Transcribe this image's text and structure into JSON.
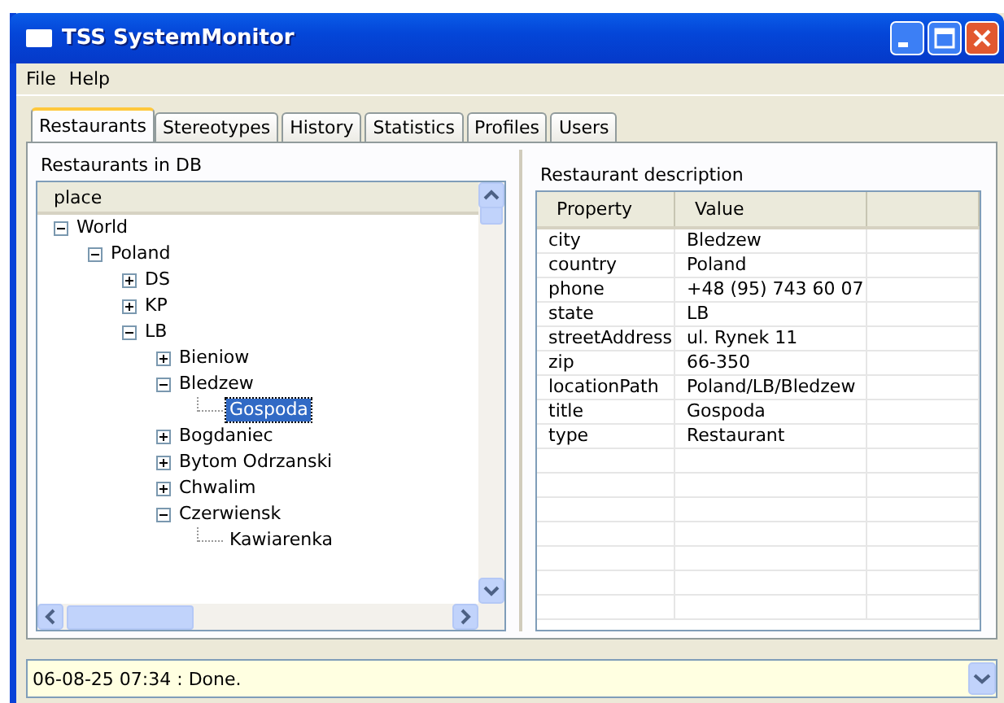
{
  "window": {
    "title": "TSS SystemMonitor"
  },
  "menu": [
    "File",
    "Help"
  ],
  "tabs": [
    {
      "label": "Restaurants",
      "selected": true
    },
    {
      "label": "Stereotypes",
      "selected": false
    },
    {
      "label": "History",
      "selected": false
    },
    {
      "label": "Statistics",
      "selected": false
    },
    {
      "label": "Profiles",
      "selected": false
    },
    {
      "label": "Users",
      "selected": false
    }
  ],
  "left_panel": {
    "title": "Restaurants in DB",
    "tree": {
      "column": "place",
      "items": [
        {
          "label": "World",
          "kind": "node",
          "expanded": true,
          "selected": false,
          "children": [
            {
              "label": "Poland",
              "kind": "node",
              "expanded": true,
              "selected": false,
              "children": [
                {
                  "label": "DS",
                  "kind": "node",
                  "expanded": false,
                  "selected": false
                },
                {
                  "label": "KP",
                  "kind": "node",
                  "expanded": false,
                  "selected": false
                },
                {
                  "label": "LB",
                  "kind": "node",
                  "expanded": true,
                  "selected": false,
                  "children": [
                    {
                      "label": "Bieniow",
                      "kind": "node",
                      "expanded": false,
                      "selected": false
                    },
                    {
                      "label": "Bledzew",
                      "kind": "node",
                      "expanded": true,
                      "selected": false,
                      "children": [
                        {
                          "label": "Gospoda",
                          "kind": "leaf",
                          "selected": true
                        }
                      ]
                    },
                    {
                      "label": "Bogdaniec",
                      "kind": "node",
                      "expanded": false,
                      "selected": false
                    },
                    {
                      "label": "Bytom Odrzanski",
                      "kind": "node",
                      "expanded": false,
                      "selected": false
                    },
                    {
                      "label": "Chwalim",
                      "kind": "node",
                      "expanded": false,
                      "selected": false
                    },
                    {
                      "label": "Czerwiensk",
                      "kind": "node",
                      "expanded": true,
                      "selected": false,
                      "children": [
                        {
                          "label": "Kawiarenka",
                          "kind": "leaf",
                          "selected": false
                        }
                      ]
                    }
                  ]
                }
              ]
            }
          ]
        }
      ]
    }
  },
  "right_panel": {
    "title": "Restaurant description",
    "table": {
      "columns": [
        "Property",
        "Value"
      ],
      "rows": [
        [
          "city",
          "Bledzew"
        ],
        [
          "country",
          "Poland"
        ],
        [
          "phone",
          "+48 (95) 743 60 07"
        ],
        [
          "state",
          "LB"
        ],
        [
          "streetAddress",
          "ul. Rynek 11"
        ],
        [
          "zip",
          "66-350"
        ],
        [
          "locationPath",
          "Poland/LB/Bledzew"
        ],
        [
          "title",
          "Gospoda"
        ],
        [
          "type",
          "Restaurant"
        ]
      ]
    }
  },
  "status_bar": {
    "text": "06-08-25 07:34 : Done."
  }
}
